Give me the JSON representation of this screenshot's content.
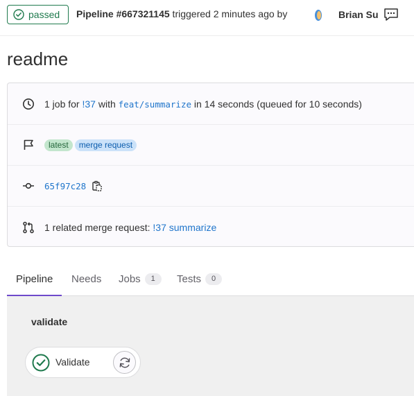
{
  "header": {
    "status": "passed",
    "pipeline_id": "Pipeline #667321145",
    "triggered_text": " triggered 2 minutes ago by ",
    "author": "Brian Su"
  },
  "title": "readme",
  "info": {
    "job_summary": {
      "prefix": "1 job for ",
      "mr_link": "!37",
      "with": " with ",
      "branch": "feat/summarize",
      "suffix": " in 14 seconds (queued for 10 seconds)"
    },
    "tags": [
      "latest",
      "merge request"
    ],
    "commit_sha": "65f97c28",
    "related_mr": {
      "prefix": "1 related merge request: ",
      "link": "!37 summarize"
    }
  },
  "tabs": [
    {
      "label": "Pipeline",
      "count": null
    },
    {
      "label": "Needs",
      "count": null
    },
    {
      "label": "Jobs",
      "count": "1"
    },
    {
      "label": "Tests",
      "count": "0"
    }
  ],
  "graph": {
    "stage": "validate",
    "job": "Validate"
  },
  "colors": {
    "success": "#1f7a4d",
    "link": "#1f75cb",
    "active_tab": "#6e49cb"
  },
  "icons": [
    "check-circle-icon",
    "comment-icon",
    "clock-icon",
    "flag-icon",
    "commit-icon",
    "copy-icon",
    "merge-request-icon",
    "retry-icon"
  ]
}
